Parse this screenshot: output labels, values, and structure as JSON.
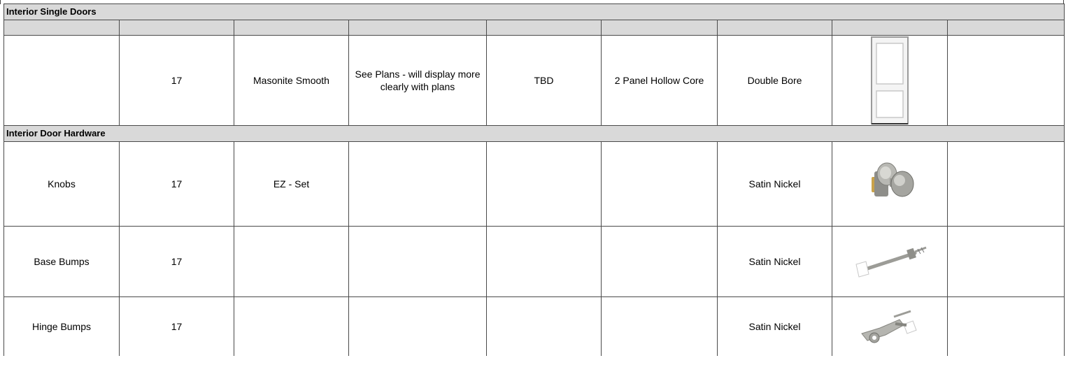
{
  "sections": [
    {
      "title": "Interior Single Doors",
      "rows": [
        {
          "item": "",
          "qty": "17",
          "brand": "Masonite Smooth",
          "description": "See Plans - will display more clearly with plans",
          "size": "TBD",
          "style": "2 Panel Hollow Core",
          "finish": "Double Bore",
          "image_icon": "door-2-panel-icon",
          "notes": ""
        }
      ]
    },
    {
      "title": "Interior Door Hardware",
      "rows": [
        {
          "item": "Knobs",
          "qty": "17",
          "brand": "EZ - Set",
          "description": "",
          "size": "",
          "style": "",
          "finish": "Satin Nickel",
          "image_icon": "door-knob-icon",
          "notes": ""
        },
        {
          "item": "Base Bumps",
          "qty": "17",
          "brand": "",
          "description": "",
          "size": "",
          "style": "",
          "finish": "Satin Nickel",
          "image_icon": "base-bump-stop-icon",
          "notes": ""
        },
        {
          "item": "Hinge Bumps",
          "qty": "17",
          "brand": "",
          "description": "",
          "size": "",
          "style": "",
          "finish": "Satin Nickel",
          "image_icon": "hinge-bump-stop-icon",
          "notes": ""
        }
      ]
    }
  ],
  "colors": {
    "header_fill": "#d9d9d9",
    "grid": "#4a4a4a",
    "nickel": "#a9a9a4"
  }
}
